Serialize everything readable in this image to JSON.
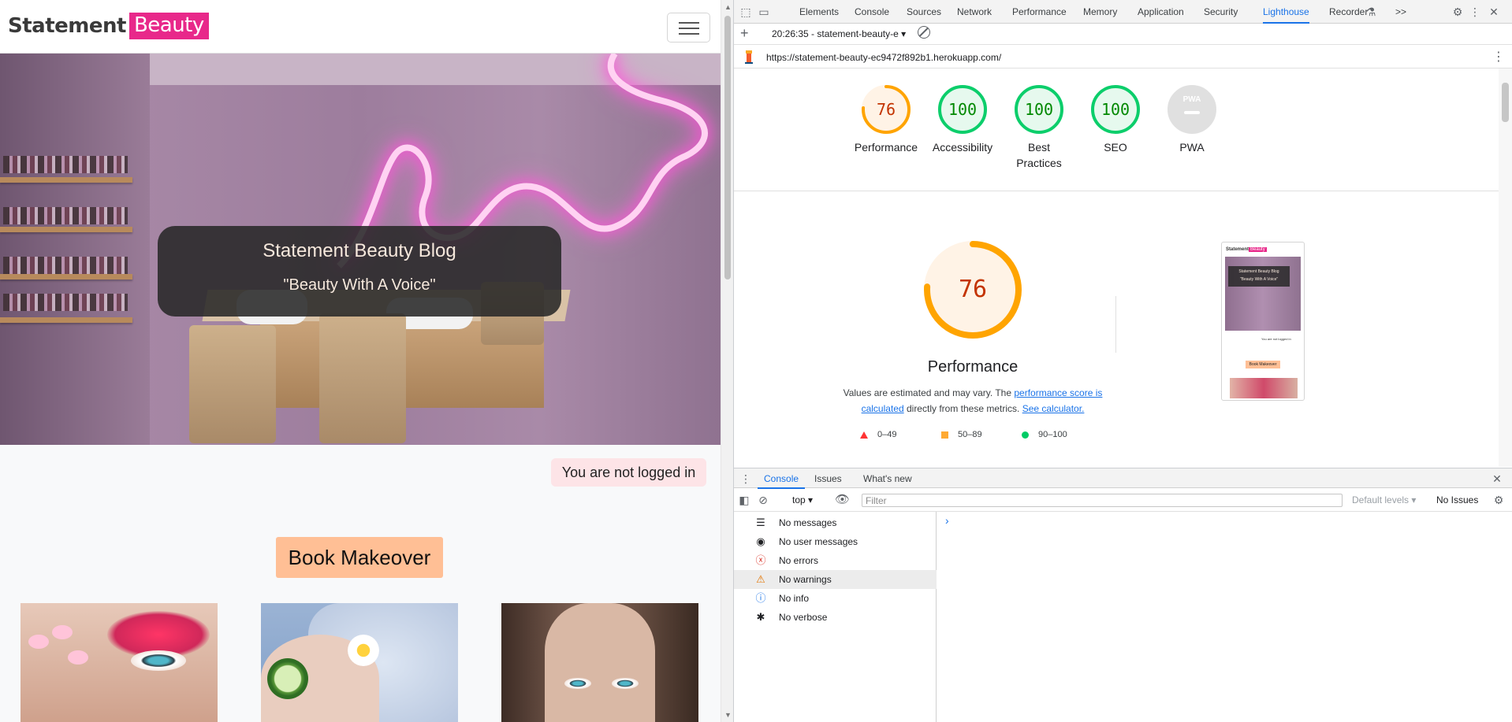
{
  "site": {
    "brand_name": "Statement",
    "brand_accent": "Beauty",
    "hero_title": "Statement Beauty Blog",
    "hero_tagline": "\"Beauty With A Voice\"",
    "login_status": "You are not logged in",
    "book_button": "Book Makeover",
    "colors": {
      "accent": "#e8288a",
      "button": "#ffbf95",
      "login_bg": "#fde4e7"
    }
  },
  "devtools": {
    "tabs": [
      "Elements",
      "Console",
      "Sources",
      "Network",
      "Performance",
      "Memory",
      "Application",
      "Security",
      "Lighthouse",
      "Recorder"
    ],
    "active_tab": "Lighthouse",
    "overflow": ">>",
    "report_select": "20:26:35 - statement-beauty-e",
    "url": "https://statement-beauty-ec9472f892b1.herokuapp.com/",
    "scores": [
      {
        "label": "Performance",
        "score": "76",
        "fraction": 0.76,
        "color": "#fa3"
      },
      {
        "label": "Accessibility",
        "score": "100",
        "fraction": 1.0,
        "color": "#0c6"
      },
      {
        "label": "Best Practices",
        "score": "100",
        "fraction": 1.0,
        "color": "#0c6"
      },
      {
        "label": "SEO",
        "score": "100",
        "fraction": 1.0,
        "color": "#0c6"
      },
      {
        "label": "PWA",
        "score": "",
        "fraction": 0,
        "color": "#9aa0a6"
      }
    ],
    "pwa_badge": "PWA",
    "perf": {
      "score": "76",
      "title": "Performance",
      "note_prefix": "Values are estimated and may vary. The ",
      "note_link1": "performance score is calculated",
      "note_middle": " directly from these metrics. ",
      "note_link2": "See calculator."
    },
    "legend": [
      {
        "range": "0–49",
        "color": "#f33"
      },
      {
        "range": "50–89",
        "color": "#fa3"
      },
      {
        "range": "90–100",
        "color": "#0c6"
      }
    ],
    "thumbnail": {
      "brand_name": "Statement",
      "brand_accent": "Beauty",
      "hero_title": "Statement Beauty Blog",
      "hero_tagline": "\"Beauty With A Voice\"",
      "login_status": "You are not logged in",
      "book_button": "Book Makeover"
    },
    "drawer_tabs": [
      "Console",
      "Issues",
      "What's new"
    ],
    "console": {
      "context": "top",
      "filter_placeholder": "Filter",
      "levels": "Default levels",
      "issues": "No Issues",
      "messages": [
        {
          "label": "No messages",
          "icon": "list-icon"
        },
        {
          "label": "No user messages",
          "icon": "user-icon"
        },
        {
          "label": "No errors",
          "icon": "error-icon"
        },
        {
          "label": "No warnings",
          "icon": "warning-icon"
        },
        {
          "label": "No info",
          "icon": "info-icon"
        },
        {
          "label": "No verbose",
          "icon": "bug-icon"
        }
      ]
    }
  }
}
